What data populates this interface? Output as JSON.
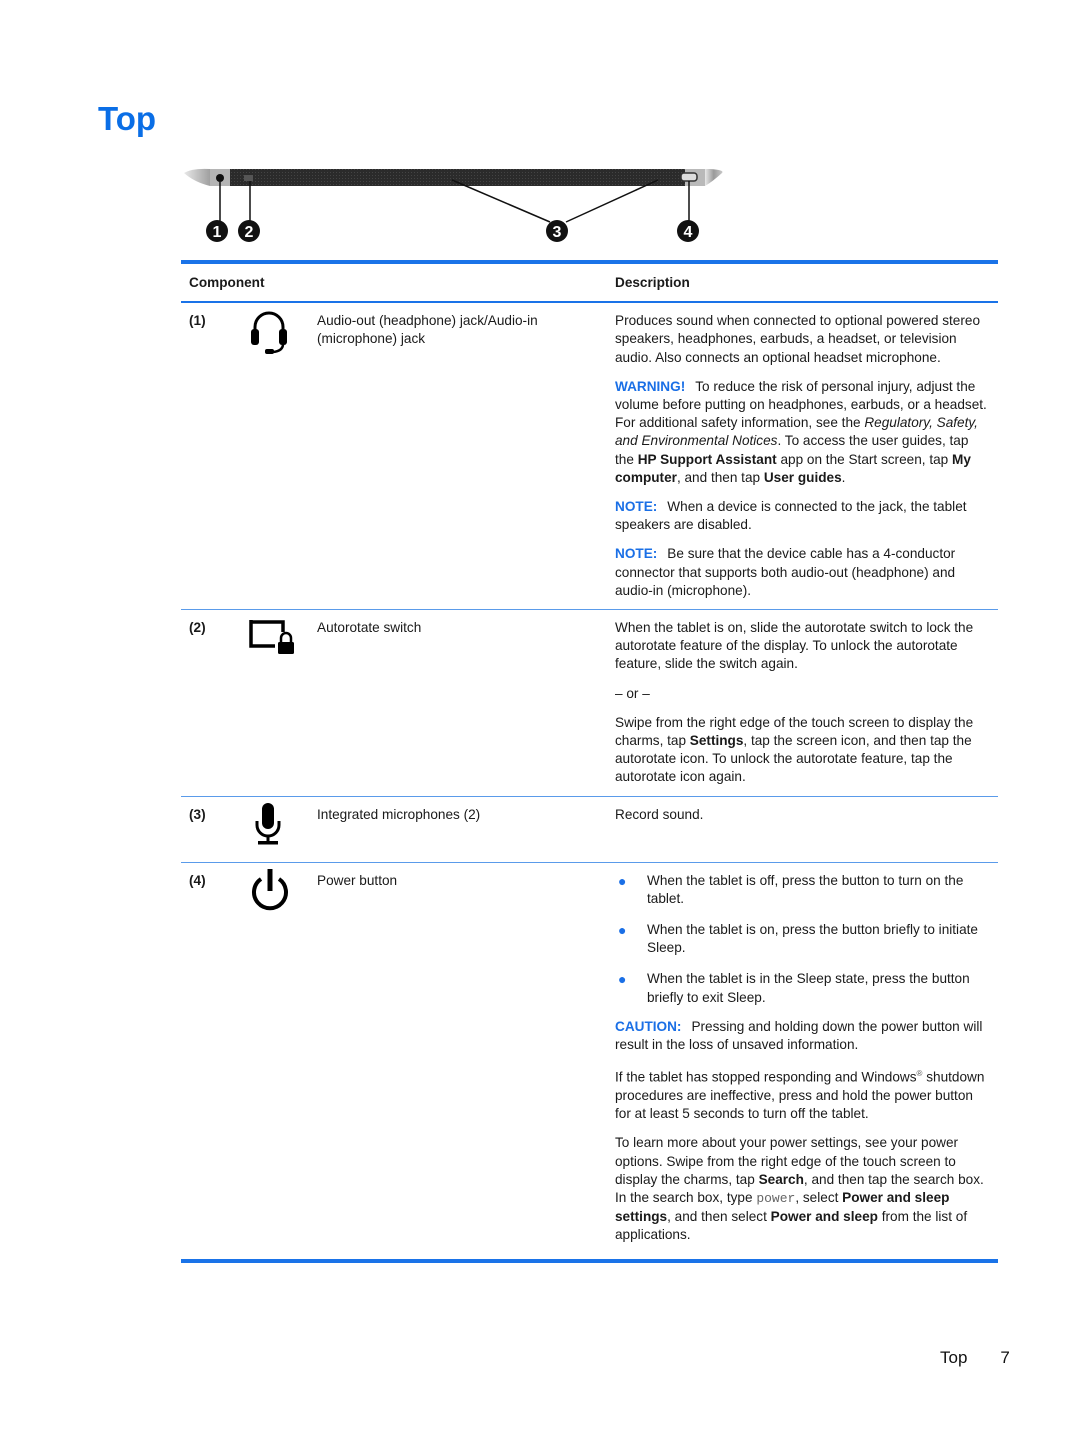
{
  "page": {
    "title": "Top",
    "footer": {
      "section": "Top",
      "page_number": "7"
    }
  },
  "illustration": {
    "callouts": [
      "1",
      "2",
      "3",
      "4"
    ]
  },
  "table": {
    "headers": {
      "component": "Component",
      "description": "Description"
    },
    "rows": [
      {
        "num": "(1)",
        "icon": "headset-icon",
        "name": "Audio-out (headphone) jack/Audio-in (microphone) jack",
        "desc": {
          "p1": "Produces sound when connected to optional powered stereo speakers, headphones, earbuds, a headset, or television audio. Also connects an optional headset microphone.",
          "warning_label": "WARNING!",
          "warning_a": "To reduce the risk of personal injury, adjust the volume before putting on headphones, earbuds, or a headset. For additional safety information, see the ",
          "warning_italic": "Regulatory, Safety, and Environmental Notices",
          "warning_b": ". To access the user guides, tap the ",
          "warning_bold1": "HP Support Assistant",
          "warning_c": " app on the Start screen, tap ",
          "warning_bold2": "My computer",
          "warning_d": ", and then tap ",
          "warning_bold3": "User guides",
          "warning_e": ".",
          "note1_label": "NOTE:",
          "note1": "When a device is connected to the jack, the tablet speakers are disabled.",
          "note2_label": "NOTE:",
          "note2": "Be sure that the device cable has a 4-conductor connector that supports both audio-out (headphone) and audio-in (microphone)."
        }
      },
      {
        "num": "(2)",
        "icon": "autorotate-lock-icon",
        "name": "Autorotate switch",
        "desc": {
          "p1": "When the tablet is on, slide the autorotate switch to lock the autorotate feature of the display. To unlock the autorotate feature, slide the switch again.",
          "or": "– or –",
          "p2a": "Swipe from the right edge of the touch screen to display the charms, tap ",
          "p2bold": "Settings",
          "p2b": ", tap the screen icon, and then tap the autorotate icon. To unlock the autorotate feature, tap the autorotate icon again."
        }
      },
      {
        "num": "(3)",
        "icon": "microphone-icon",
        "name": "Integrated microphones (2)",
        "desc": {
          "p1": "Record sound."
        }
      },
      {
        "num": "(4)",
        "icon": "power-icon",
        "name": "Power button",
        "desc": {
          "bullets": [
            "When the tablet is off, press the button to turn on the tablet.",
            "When the tablet is on, press the button briefly to initiate Sleep.",
            "When the tablet is in the Sleep state, press the button briefly to exit Sleep."
          ],
          "bullet_glyph": "●",
          "caution_label": "CAUTION:",
          "caution": "Pressing and holding down the power button will result in the loss of unsaved information.",
          "p2a": "If the tablet has stopped responding and Windows",
          "p2reg": "®",
          "p2b": " shutdown procedures are ineffective, press and hold the power button for at least 5 seconds to turn off the tablet.",
          "p3a": "To learn more about your power settings, see your power options. Swipe from the right edge of the touch screen to display the charms, tap ",
          "p3bold1": "Search",
          "p3b": ", and then tap the search box. In the search box, type ",
          "p3mono": "power",
          "p3c": ", select ",
          "p3bold2": "Power and sleep settings",
          "p3d": ", and then select ",
          "p3bold3": "Power and sleep",
          "p3e": " from the list of applications."
        }
      }
    ]
  },
  "colors": {
    "accent": "#1a73e8",
    "title": "#0a6ee6"
  }
}
